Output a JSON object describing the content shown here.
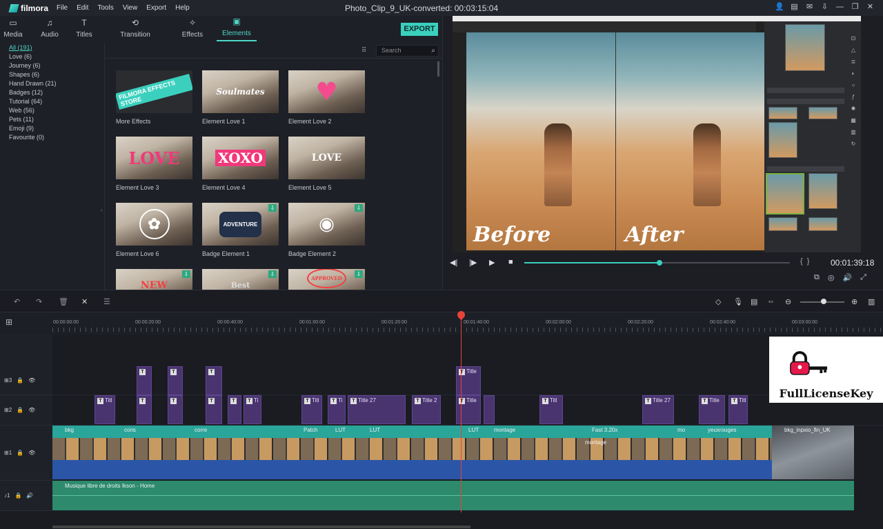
{
  "app": {
    "logo_text": "filmora",
    "menu": [
      "File",
      "Edit",
      "Tools",
      "View",
      "Export",
      "Help"
    ],
    "window_title": "Photo_Clip_9_UK-converted:  00:03:15:04"
  },
  "tabs": [
    {
      "label": "Media",
      "icon": "folder-icon"
    },
    {
      "label": "Audio",
      "icon": "music-note-icon"
    },
    {
      "label": "Titles",
      "icon": "title-text-icon"
    },
    {
      "label": "Transition",
      "icon": "transition-icon"
    },
    {
      "label": "Effects",
      "icon": "effects-icon"
    },
    {
      "label": "Elements",
      "icon": "image-icon"
    }
  ],
  "export_label": "EXPORT",
  "categories": [
    "All (191)",
    "Love (6)",
    "Journey (6)",
    "Shapes (6)",
    "Hand Drawn (21)",
    "Badges (12)",
    "Tutorial (64)",
    "Web (56)",
    "Pets (11)",
    "Emoji (9)",
    "Favourite (0)"
  ],
  "search_placeholder": "Search",
  "elements": [
    {
      "label": "More Effects",
      "overlay": "FILMORA EFFECTS STORE"
    },
    {
      "label": "Element Love 1",
      "overlay": "Soulmates"
    },
    {
      "label": "Element Love 2",
      "overlay": "♥"
    },
    {
      "label": "Element Love 3",
      "overlay": "LOVE"
    },
    {
      "label": "Element Love 4",
      "overlay": "XOXO"
    },
    {
      "label": "Element Love 5",
      "overlay": "LOVE"
    },
    {
      "label": "Element Love 6",
      "overlay": "✿"
    },
    {
      "label": "Badge Element 1",
      "overlay": "ADVENTURE"
    },
    {
      "label": "Badge Element 2",
      "overlay": "◉"
    },
    {
      "label": "",
      "overlay": "NEW"
    },
    {
      "label": "",
      "overlay": "Best"
    },
    {
      "label": "",
      "overlay": "APPROVED"
    }
  ],
  "preview": {
    "caption_before": "Before",
    "caption_after": "After",
    "timecode": "00:01:39:18",
    "progress": 0.51
  },
  "ruler_labels": [
    "00:00:00:00",
    "00:00:20:00",
    "00:00:40:00",
    "00:01:00:00",
    "00:01:20:00",
    "00:01:40:00",
    "00:02:00:00",
    "00:02:20:00",
    "00:02:40:00",
    "00:03:00:00"
  ],
  "tracks": {
    "title3": {
      "number": "3"
    },
    "title2": {
      "number": "2"
    },
    "video1": {
      "number": "1"
    },
    "audio1": {
      "number": "1"
    }
  },
  "track3_clips": [
    "T",
    "T",
    "T",
    "Title"
  ],
  "track2_clips": [
    "Titl",
    "T",
    "T",
    "T",
    "T",
    "Ti",
    "Titl",
    "Ti",
    "Title 27",
    "Title 2",
    "Title",
    "",
    "Titl",
    "Title 27",
    "Title",
    "Titl"
  ],
  "video_labels": [
    "bkg",
    "cons",
    "corre",
    "Patch",
    "LUT",
    "LUT",
    "LUT",
    "montage",
    "Fast 3.20x",
    "montage",
    "mo",
    "yeuxrouges",
    "bkg_inpxio_fin_UK"
  ],
  "audio_label": "Musique libre de droits Ikson - Home",
  "watermark_text": "FullLicenseKey"
}
